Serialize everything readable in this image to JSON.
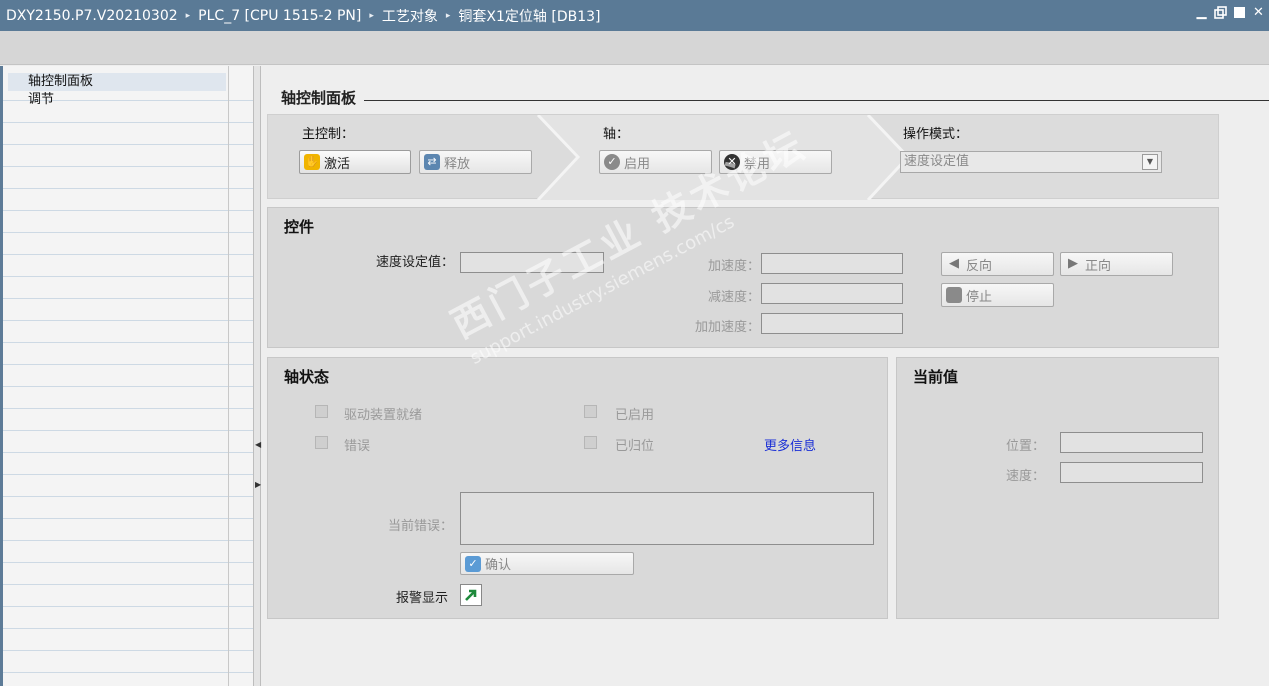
{
  "titlebar": {
    "crumbs": [
      "DXY2150.P7.V20210302",
      "PLC_7 [CPU 1515-2 PN]",
      "工艺对象",
      "铜套X1定位轴 [DB13]"
    ],
    "separator": "▸"
  },
  "nav": {
    "items": [
      {
        "label": "轴控制面板",
        "active": true
      },
      {
        "label": "调节",
        "active": false
      }
    ]
  },
  "page": {
    "title": "轴控制面板"
  },
  "master": {
    "label": "主控制：",
    "activate": "激活",
    "release": "释放"
  },
  "axis": {
    "label": "轴：",
    "enable": "启用",
    "disable": "禁用"
  },
  "mode": {
    "label": "操作模式：",
    "value": "速度设定值"
  },
  "controls": {
    "title": "控件",
    "speed_setpoint": "速度设定值：",
    "accel": "加速度：",
    "decel": "减速度：",
    "jerk": "加加速度：",
    "reverse": "反向",
    "forward": "正向",
    "stop": "停止"
  },
  "axis_status": {
    "title": "轴状态",
    "drive_ready": "驱动装置就绪",
    "error": "错误",
    "enabled": "已启用",
    "homed": "已归位",
    "more_info": "更多信息",
    "current_error": "当前错误：",
    "confirm": "确认",
    "alarm_display": "报警显示"
  },
  "current_values": {
    "title": "当前值",
    "position": "位置：",
    "speed": "速度："
  },
  "watermark": {
    "line1": "西门子工业 技术论坛",
    "line2": "support.industry.siemens.com/cs"
  },
  "colors": {
    "titlebar": "#5a7a96",
    "link": "#1a2fd6"
  }
}
